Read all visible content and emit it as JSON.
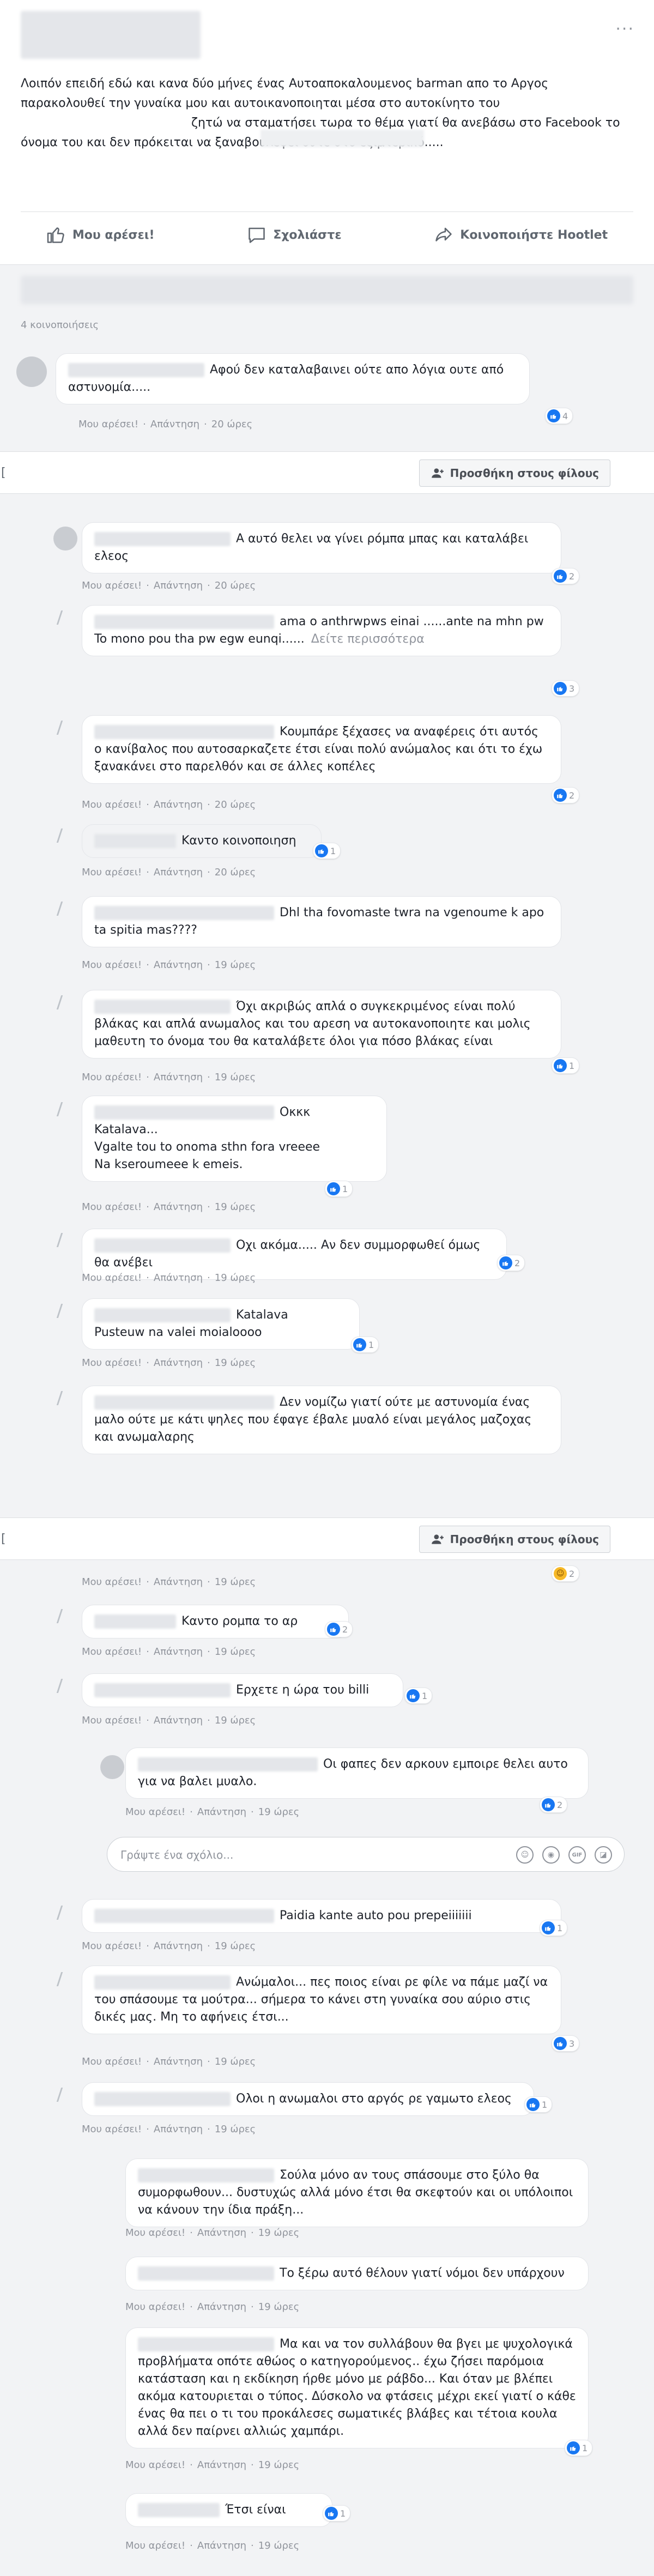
{
  "post": {
    "menu": "···",
    "text": "Λοιπόν επειδή εδώ και κανα δύο μήνες ένας Αυτοαποκαλουμενος barman απο το Αργος παρακολουθεί την γυναίκα μου και αυτοικανοποιηται μέσα στο αυτοκίνητο του",
    "text_cont": "ζητώ να σταματήσει τωρα το θέμα γιατί θα ανεβάσω στο Facebook το όνομα του και δεν πρόκειται να ξαναβουλεψει ούτε στο εξιμτερικό.....",
    "actions": {
      "like": "Μου αρέσει!",
      "comment": "Σχολιάστε",
      "share": "Κοινοποιήστε Hootlet"
    }
  },
  "shares": "4 κοινοποιήσεις",
  "add_friend_label": "Προσθήκη στους φίλους",
  "reply_placeholder": "Γράψτε ένα σχόλιο...",
  "meta": {
    "like": "Μου αρέσει!",
    "reply": "Απάντηση",
    "sep": "·"
  },
  "comments": [
    {
      "text": "Αφού δεν καταλαβαινει ούτε απο λόγια ουτε από αστυνομία.....",
      "time": "20 ώρες",
      "likes": "4"
    },
    {
      "text": "Α αυτό θελει να γίνει ρόμπα μπας και καταλάβει ελεος",
      "time": "20 ώρες",
      "likes": "2"
    },
    {
      "text": "ama o anthrwpws einai ......ante na mhn pw\nTo mono pou tha pw egw eunqi......",
      "see_more": "Δείτε περισσότερα",
      "time": "20 ώρες",
      "likes": "3"
    },
    {
      "text": "Κουμπάρε ξέχασες να αναφέρεις ότι αυτός ο κανίβαλος που αυτοσαρκαζετε έτσι είναι πολύ ανώμαλος και ότι το έχω ξανακάνει στο παρελθόν και σε άλλες κοπέλες",
      "time": "20 ώρες",
      "likes": "2"
    },
    {
      "text": "Καντο κοινοποιηση",
      "time": "20 ώρες",
      "likes": "1"
    },
    {
      "text": "Dhl tha fovomaste twra na vgenoume k apo ta spitia mas????",
      "time": "19 ώρες",
      "likes": ""
    },
    {
      "text": "Όχι ακριβώς απλά ο συγκεκριμένος είναι πολύ βλάκας και απλά ανωμαλος και του αρεση να αυτοκανοποιητε και μολις μαθευτη το όνομα του θα καταλάβετε όλοι για πόσο βλάκας είναι",
      "time": "19 ώρες",
      "likes": "1"
    },
    {
      "text": "Οκκκ\nKatalava...\nVgalte tou to onoma sthn fora vreeee\nNa kseroumeee k emeis.",
      "time": "19 ώρες",
      "likes": "1"
    },
    {
      "text": "Οχι ακόμα..... Αν δεν συμμορφωθεί όμως θα ανέβει",
      "time": "19 ώρες",
      "likes": "2"
    },
    {
      "text": "Katalava\nPusteuw na valei moialoooo",
      "time": "19 ώρες",
      "likes": "1"
    },
    {
      "text": "Δεν νομίζω γιατί ούτε με αστυνομία ένας μαλο ούτε με κάτι ψηλες που έφαγε έβαλε μυαλό είναι μεγάλος μαζοχας και ανωμαλαρης",
      "time": "19 ώρες",
      "likes": "2"
    },
    {
      "text": "Καντο ρομπα το αρ",
      "time": "19 ώρες",
      "likes": "2"
    },
    {
      "text": "Ερχετε η ώρα του billi",
      "time": "19 ώρες",
      "likes": "1"
    },
    {
      "text": "Οι φαπες δεν αρκουν εμποιρε θελει αυτο για να βαλει μυαλο.",
      "time": "19 ώρες",
      "likes": "2"
    },
    {
      "text": "Paidia kante auto pou prepeiiiiiii",
      "time": "19 ώρες",
      "likes": "1"
    },
    {
      "text": "Ανώμαλοι... πες ποιος είναι ρε φίλε να πάμε μαζί να του σπάσουμε τα μούτρα... σήμερα το κάνει στη γυναίκα σου αύριο στις δικές μας. Μη το αφήνεις έτσι...",
      "time": "19 ώρες",
      "likes": "3"
    },
    {
      "text": "Ολοι η ανωμαλοι στο αργός ρε γαμωτο ελεος",
      "time": "19 ώρες",
      "likes": "1"
    },
    {
      "text": "Σούλα μόνο αν τους σπάσουμε στο ξύλο θα συμορφωθουν... δυστυχώς αλλά μόνο έτσι θα σκεφτούν και οι υπόλοιποι να κάνουν την ίδια πράξη...",
      "time": "19 ώρες",
      "likes": ""
    },
    {
      "text": "Το ξέρω αυτό θέλουν γιατί νόμοι δεν υπάρχουν",
      "time": "19 ώρες",
      "likes": ""
    },
    {
      "text": "Μα και να τον συλλάβουν θα βγει με ψυχολογικά προβλήματα οπότε αθώος ο κατηγορούμενος.. έχω ζήσει παρόμοια κατάσταση και η εκδίκηση ήρθε μόνο με ράβδο... Και όταν με βλέπει ακόμα κατουριεται ο τύπος. Δύσκολο να φτάσεις μέχρι εκεί γιατί ο κάθε ένας θα πει ο τι του προκάλεσες σωματικές βλάβες και τέτοια κουλα αλλά δεν παίρνει αλλιώς χαμπάρι.",
      "time": "19 ώρες",
      "likes": "1"
    },
    {
      "text": "Έτσι είναι",
      "time": "19 ώρες",
      "likes": "1"
    }
  ],
  "colors": {
    "like_blue": "#1877f2",
    "meta_grey": "#90949c",
    "page_bg": "#e9ebee"
  },
  "icons": [
    "thumbs-up-icon",
    "comment-icon",
    "share-icon",
    "add-friend-icon",
    "like-reaction-icon",
    "haha-reaction-icon",
    "emoji-icon",
    "camera-icon",
    "gif-icon",
    "sticker-icon"
  ]
}
